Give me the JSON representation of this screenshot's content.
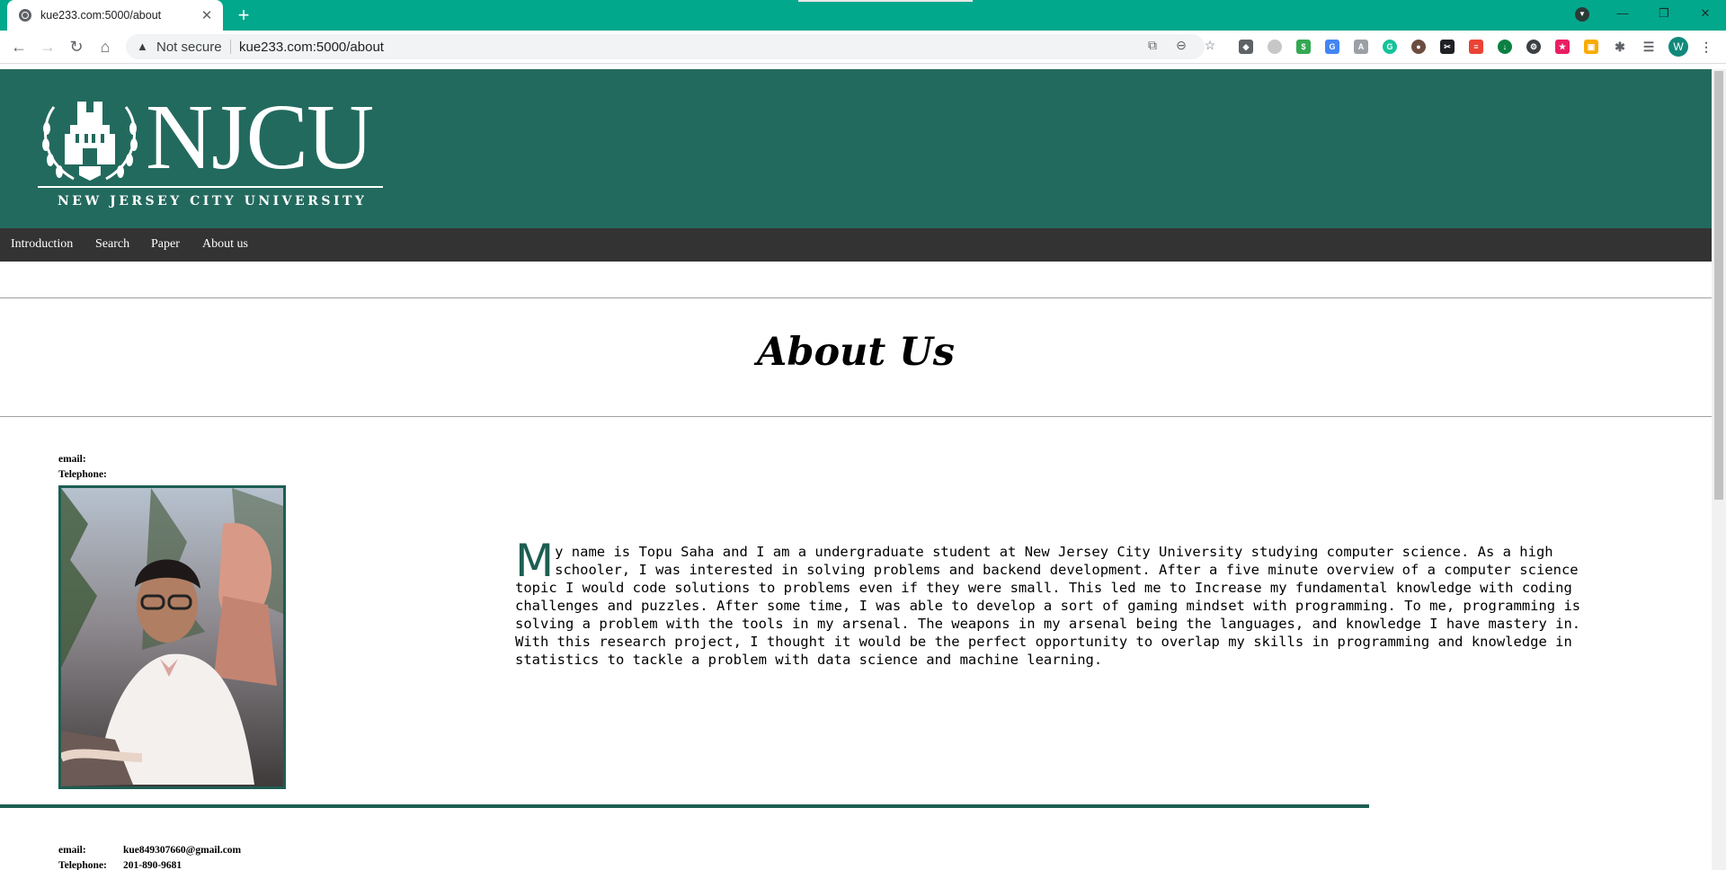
{
  "browser": {
    "tab_title": "kue233.com:5000/about",
    "security_label": "Not secure",
    "url": "kue233.com:5000/about",
    "profile_initial": "W"
  },
  "site": {
    "logo_text": "NJCU",
    "logo_subtitle": "NEW JERSEY CITY UNIVERSITY",
    "nav": [
      "Introduction",
      "Search",
      "Paper",
      "About us"
    ]
  },
  "page": {
    "title": "About Us"
  },
  "members": [
    {
      "email_label": "email:",
      "email": "",
      "telephone_label": "Telephone:",
      "telephone": "",
      "bio_first_letter": "M",
      "bio_rest": "y name is Topu Saha and I am a undergraduate student at New Jersey City University studying computer science. As a high schooler, I was interested in solving problems and backend development. After a five minute overview of a computer science topic I would code solutions to problems even if they were small. This led me to Increase my fundamental knowledge with coding challenges and puzzles. After some time, I was able to develop a sort of gaming mindset with programming. To me, programming is solving a problem with the tools in my arsenal. The weapons in my arsenal being the languages, and knowledge I have mastery in. With this research project, I thought it would be the perfect opportunity to overlap my skills in programming and knowledge in statistics to tackle a problem with data science and machine learning."
    },
    {
      "email_label": "email:",
      "email": "kue849307660@gmail.com",
      "telephone_label": "Telephone:",
      "telephone": "201-890-9681"
    }
  ],
  "colors": {
    "chrome_teal": "#02a88c",
    "header_green": "#236a5e",
    "navbar_dark": "#333333",
    "accent_green": "#1d5e52"
  }
}
